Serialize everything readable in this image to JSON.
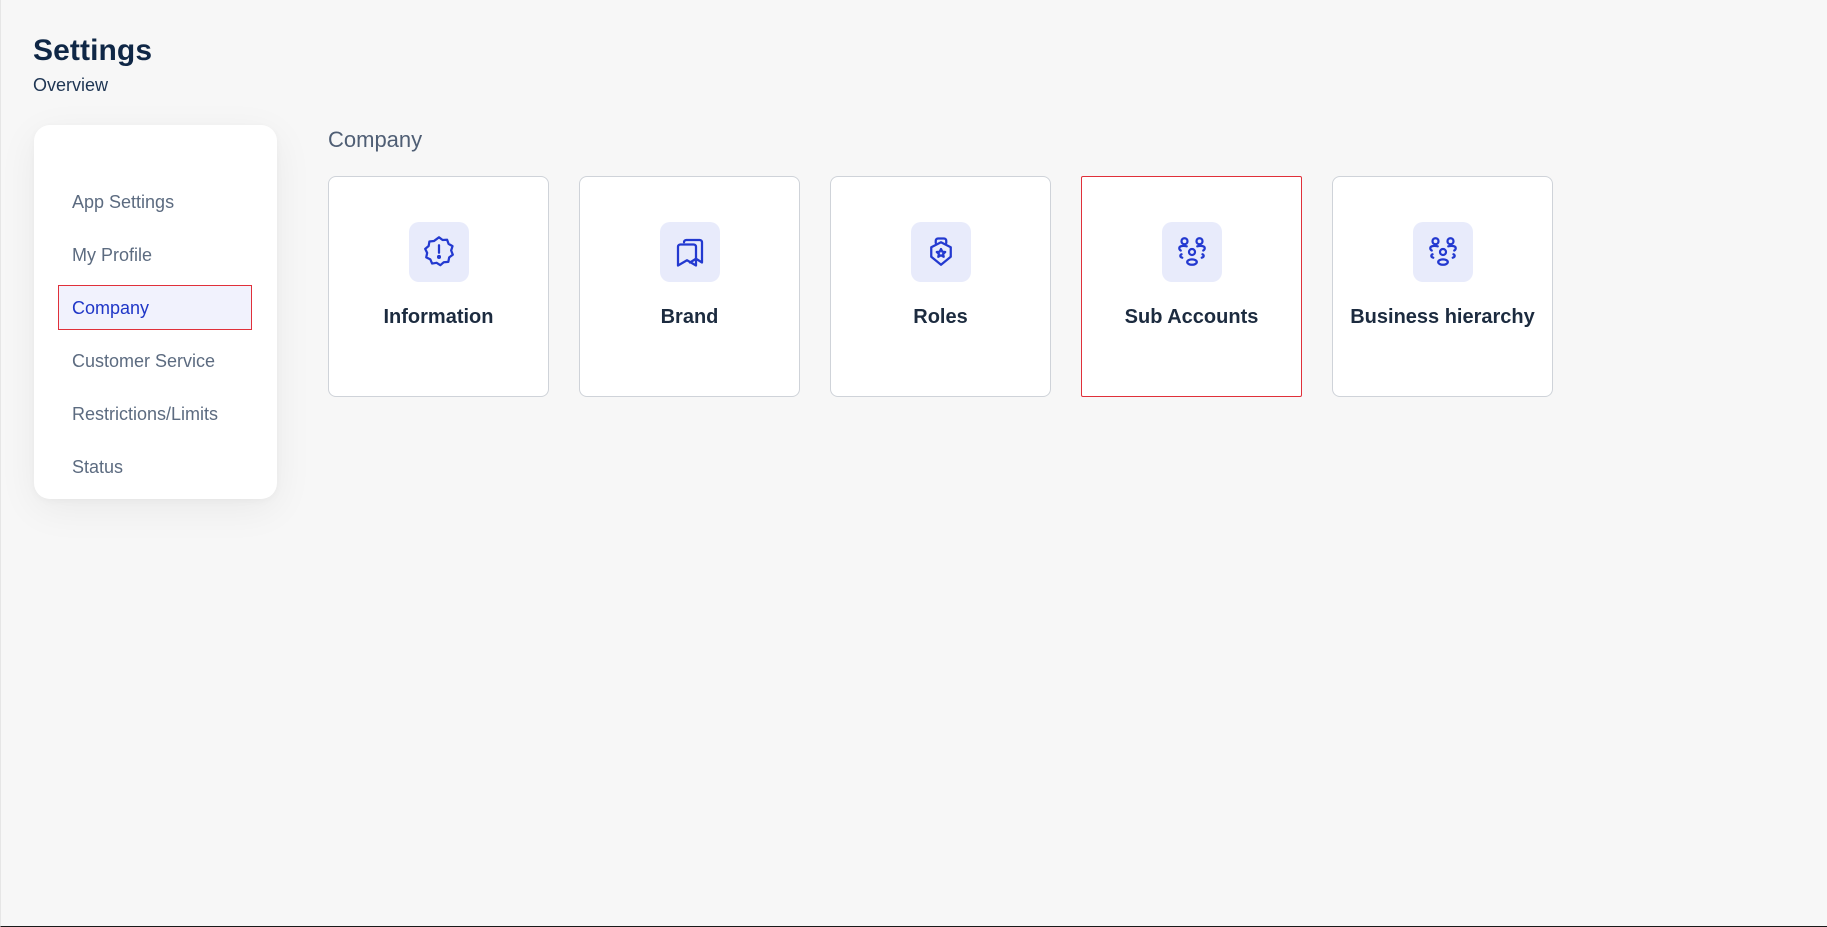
{
  "header": {
    "title": "Settings",
    "subtitle": "Overview"
  },
  "sidebar": {
    "items": [
      {
        "label": "App Settings"
      },
      {
        "label": "My Profile"
      },
      {
        "label": "Company",
        "active": true
      },
      {
        "label": "Customer Service"
      },
      {
        "label": "Restrictions/Limits"
      },
      {
        "label": "Status"
      }
    ]
  },
  "main": {
    "section_title": "Company",
    "cards": [
      {
        "label": "Information",
        "icon": "alert-badge-icon"
      },
      {
        "label": "Brand",
        "icon": "bookmarks-icon"
      },
      {
        "label": "Roles",
        "icon": "shield-badge-icon"
      },
      {
        "label": "Sub Accounts",
        "icon": "people-group-icon",
        "selected": true
      },
      {
        "label": "Business hierarchy",
        "icon": "people-group-icon"
      }
    ]
  },
  "colors": {
    "accent": "#1f36c7",
    "icon_bg": "#e8ebfb",
    "highlight_border": "#e0303a",
    "background": "#f7f7f7"
  }
}
